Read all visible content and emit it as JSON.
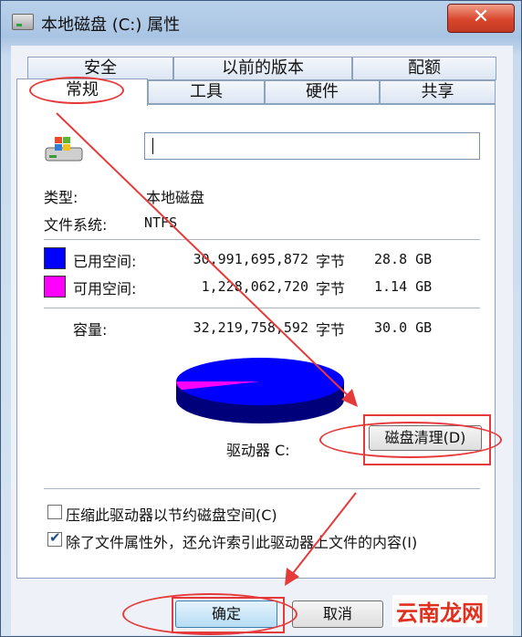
{
  "window": {
    "title": "本地磁盘 (C:) 属性",
    "close_label": "✕"
  },
  "tabs": {
    "row1": [
      "安全",
      "以前的版本",
      "配额"
    ],
    "row2": [
      "常规",
      "工具",
      "硬件",
      "共享"
    ],
    "active": "常规"
  },
  "general": {
    "label_value": "",
    "type_label": "类型:",
    "type_value": "本地磁盘",
    "fs_label": "文件系统:",
    "fs_value": "NTFS",
    "used": {
      "label": "已用空间:",
      "bytes": "30,991,695,872",
      "unit": "字节",
      "size": "28.8 GB",
      "color": "#0000ff"
    },
    "free": {
      "label": "可用空间:",
      "bytes": "1,228,062,720",
      "unit": "字节",
      "size": "1.14 GB",
      "color": "#ff00ff"
    },
    "capacity": {
      "label": "容量:",
      "bytes": "32,219,758,592",
      "unit": "字节",
      "size": "30.0 GB"
    },
    "drive_label": "驱动器 C:",
    "cleanup_button": "磁盘清理(D)",
    "compress_label": "压缩此驱动器以节约磁盘空间(C)",
    "compress_checked": false,
    "index_label": "除了文件属性外，还允许索引此驱动器上文件的内容(I)",
    "index_checked": true,
    "used_fraction": 0.962
  },
  "footer": {
    "ok": "确定",
    "cancel": "取消"
  },
  "watermark": "云南龙网"
}
